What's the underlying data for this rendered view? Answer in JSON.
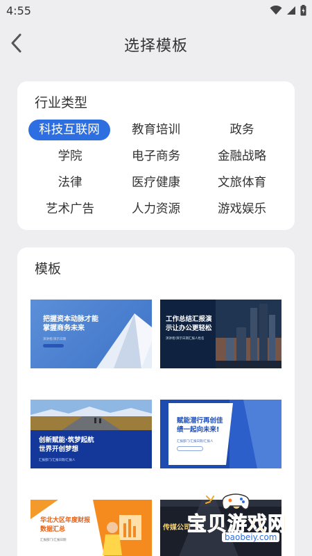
{
  "status": {
    "time": "4:55"
  },
  "header": {
    "title": "选择模板"
  },
  "industry": {
    "title": "行业类型",
    "items": [
      "科技互联网",
      "教育培训",
      "政务",
      "学院",
      "电子商务",
      "金融战略",
      "法律",
      "医疗健康",
      "文旅体育",
      "艺术广告",
      "人力资源",
      "游戏娱乐"
    ],
    "selected": "科技互联网"
  },
  "templates": {
    "title": "模板",
    "cards": [
      {
        "headline_1": "把握资本动脉才能",
        "headline_2": "掌握商务未来",
        "caption": "演讲者/演示日期"
      },
      {
        "headline_1": "工作总结汇报演",
        "headline_2": "示让办公更轻松",
        "caption": "演讲者/演示日期汇报人姓名"
      },
      {
        "headline_1": "创新赋能·筑梦起航",
        "headline_2": "世界开创梦想",
        "caption": "汇报部门/汇报日期/汇报人"
      },
      {
        "headline_1": "赋能潜行再创佳",
        "headline_2": "绩一起向未来!",
        "caption": "汇报部门/汇报日期/汇报人"
      },
      {
        "headline_1": "华北大区年度财报",
        "headline_2": "数据汇总",
        "caption": "汇报部门/汇报日期"
      },
      {
        "headline_1": "传媒公司",
        "headline_2": "",
        "caption": ""
      }
    ]
  },
  "watermark": {
    "text": "宝贝游戏网",
    "url": "baobeiy.com"
  },
  "colors": {
    "accent": "#2d6fe0",
    "background": "#eeeef0"
  }
}
